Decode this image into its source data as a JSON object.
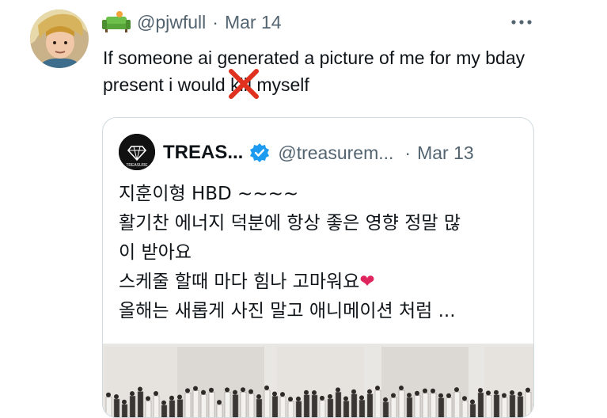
{
  "tweet": {
    "handle": "@pjwfull",
    "separator": "·",
    "date": "Mar 14",
    "text_before": "If someone ai generated a picture of me for my bday present i would ",
    "struck_word": "kill",
    "text_after": " myself",
    "avatar_icon": "profile-photo",
    "name_icon": "couch-emoji",
    "menu_icon": "more-horizontal-icon"
  },
  "quote": {
    "name": "TREAS...",
    "handle": "@treasurem...",
    "separator": "·",
    "date": "Mar 13",
    "avatar_text": "TREASURE",
    "verified_icon": "verified-badge-icon",
    "line1": "지훈이형 HBD ~~~~",
    "line2": "활기찬 에너지 덕분에 항상 좋은 영향 정말 많\n이 받아요",
    "line3": "스케줄 할때 마다 힘나 고마워요",
    "heart": "❤",
    "line4": "올해는 새롭게 사진 말고 애니메이션 처럼 ...",
    "media": "group-photo-strip"
  },
  "colors": {
    "secondary_text": "#536471",
    "verified_blue": "#1d9bf0",
    "strike_red": "#e0301e",
    "heart_red": "#e0245e"
  }
}
